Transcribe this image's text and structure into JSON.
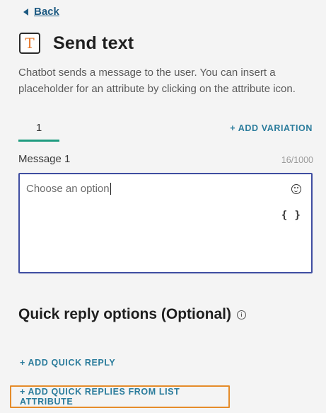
{
  "back": {
    "label": "Back",
    "icon": "caret-left-icon"
  },
  "header": {
    "icon": "text-block-icon",
    "icon_glyph": "T",
    "title": "Send text"
  },
  "description": "Chatbot sends a message to the user. You can insert a placeholder for an attribute by clicking on the attribute icon.",
  "tabs": [
    {
      "label": "1",
      "active": true
    }
  ],
  "add_variation_label": "+ ADD VARIATION",
  "message": {
    "label": "Message 1",
    "counter": "16/1000",
    "value": "Choose an option",
    "emoji_icon": "emoji-icon",
    "attribute_icon": "attribute-braces-icon",
    "attribute_glyph": "{ }"
  },
  "quick_reply": {
    "heading": "Quick reply options (Optional)",
    "info_glyph": "i",
    "add_label": "+ ADD QUICK REPLY",
    "add_from_list_label": "+ ADD QUICK REPLIES FROM LIST ATTRIBUTE"
  },
  "colors": {
    "accent_teal": "#1f9c80",
    "link_blue": "#2b7c9c",
    "focus_border": "#3f4ea1",
    "highlight_orange": "#e58c2a"
  }
}
